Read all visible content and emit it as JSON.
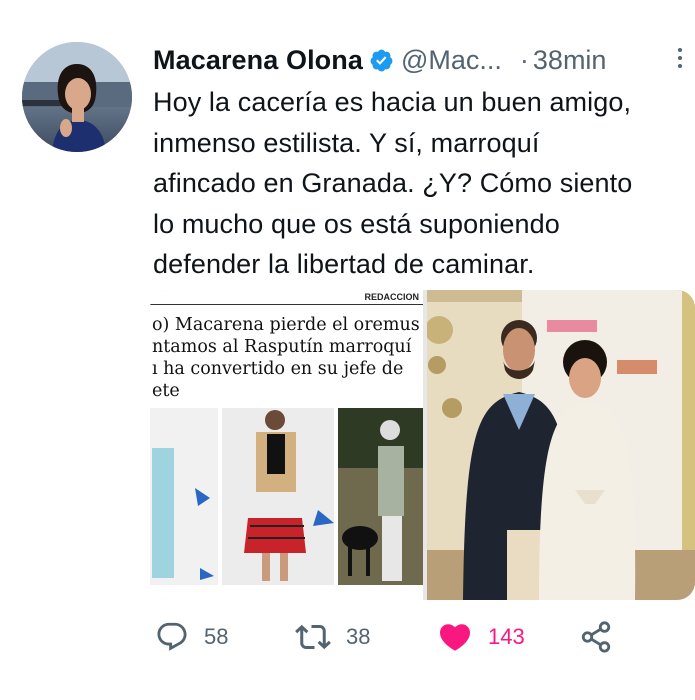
{
  "tweet": {
    "author": {
      "name": "Macarena Olona",
      "handle": "@Mac...",
      "verified": true
    },
    "time_sep": "·",
    "time": "38min",
    "text_lines": [
      "Hoy la cacería es hacia un buen amigo,",
      "inmenso estilista. Y sí, marroquí",
      "afincado en Granada. ¿Y? Cómo siento",
      "lo mucho que os está suponiendo",
      "defender la libertad de caminar."
    ],
    "media": {
      "article_section": "REDACCION",
      "article_headline_lines": [
        "o) Macarena pierde el oremus",
        "ntamos al Rasputín marroquí",
        "ı ha convertido en su jefe de",
        "ete"
      ]
    },
    "actions": {
      "reply_count": "58",
      "retweet_count": "38",
      "like_count": "143",
      "liked": true
    },
    "colors": {
      "verified": "#1d9bf0",
      "like": "#f91880",
      "secondary_text": "#536471"
    }
  }
}
